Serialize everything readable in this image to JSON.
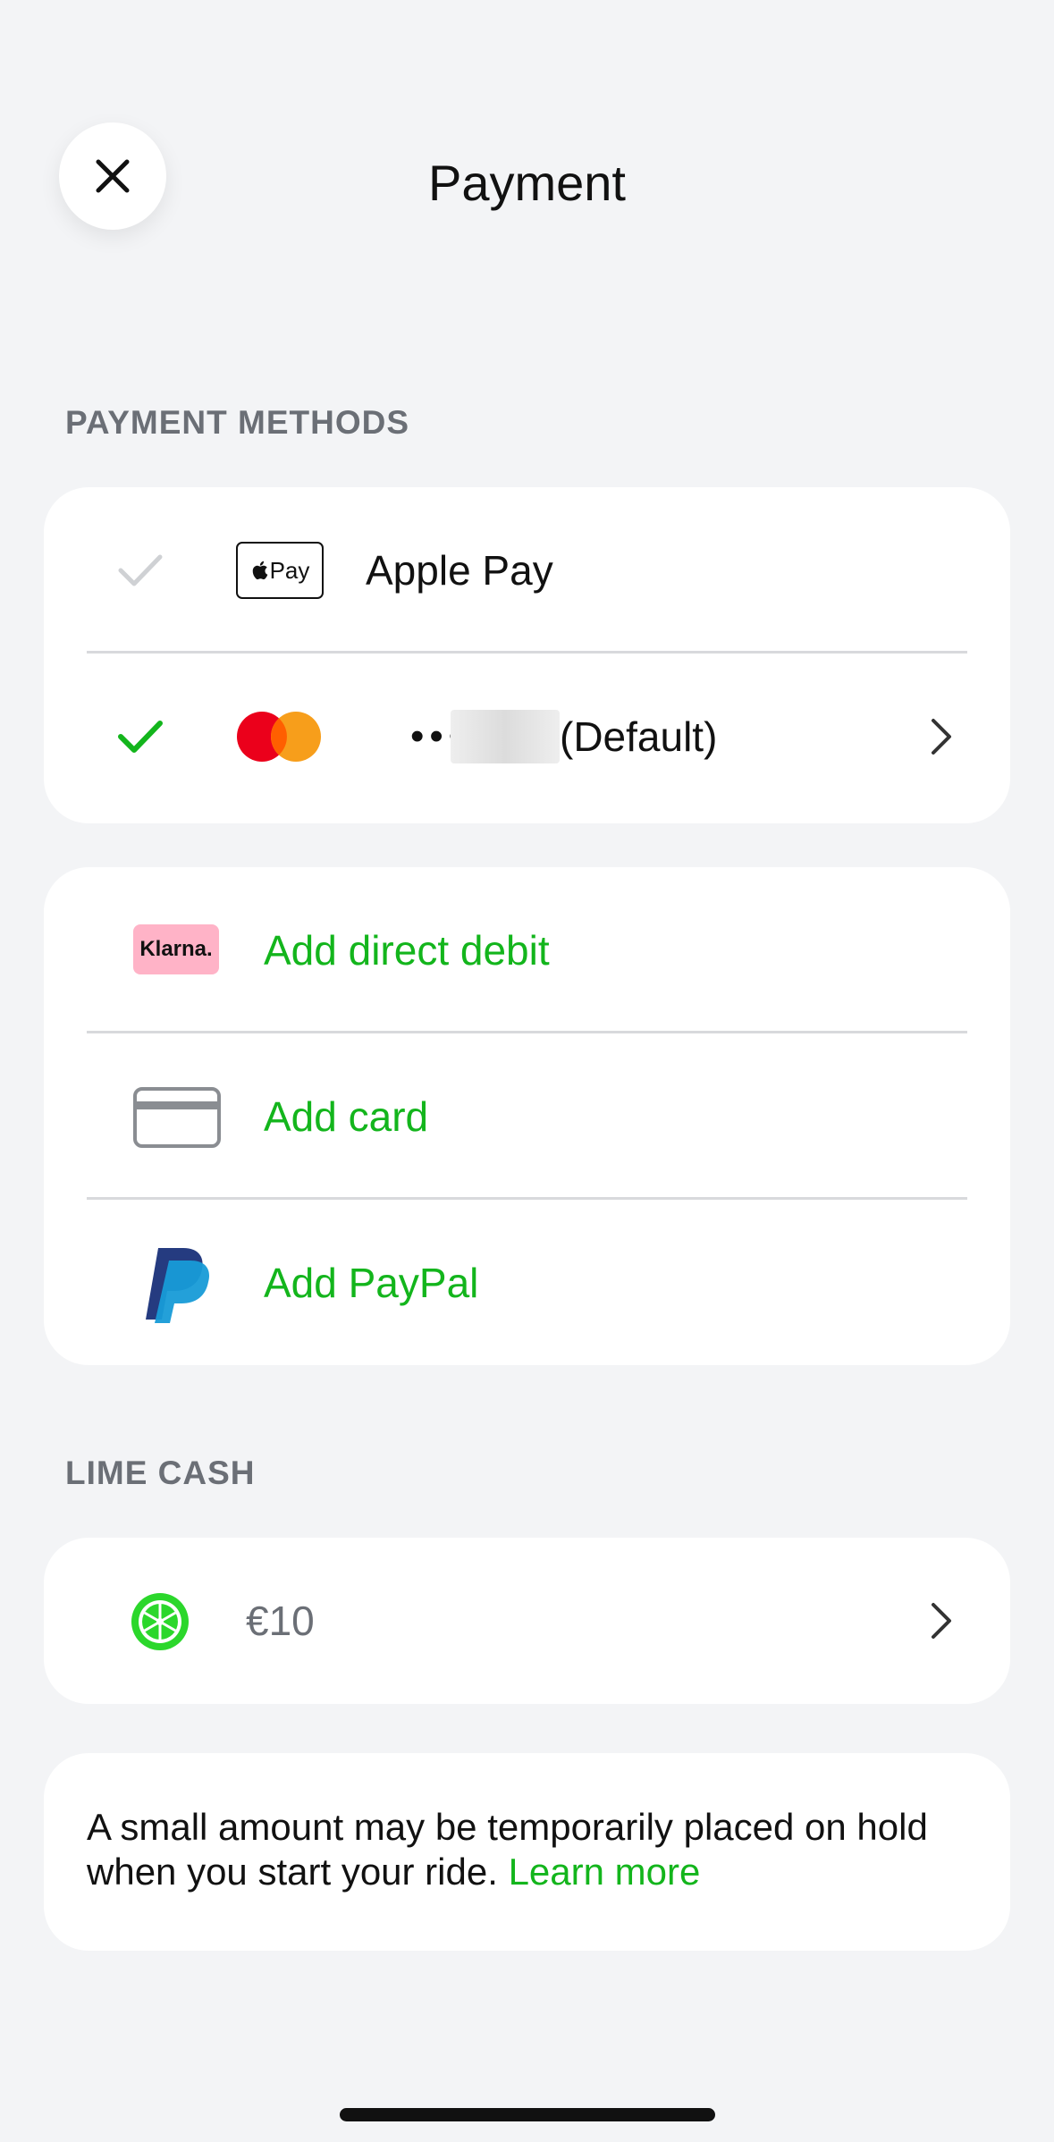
{
  "header": {
    "title": "Payment",
    "close_icon": "close-icon"
  },
  "payment_methods": {
    "section_label": "PAYMENT METHODS",
    "items": [
      {
        "icon": "apple-pay-icon",
        "badge_text": "Pay",
        "label": "Apple Pay",
        "selected": false
      },
      {
        "icon": "mastercard-icon",
        "masked_prefix": "••••",
        "suffix": "(Default)",
        "selected": true,
        "chevron": "chevron-right-icon"
      }
    ]
  },
  "add_methods": {
    "items": [
      {
        "icon": "klarna-icon",
        "badge_text": "Klarna.",
        "label": "Add direct debit"
      },
      {
        "icon": "card-icon",
        "label": "Add card"
      },
      {
        "icon": "paypal-icon",
        "label": "Add PayPal"
      }
    ]
  },
  "lime_cash": {
    "section_label": "LIME CASH",
    "icon": "lime-icon",
    "balance": "€10",
    "chevron": "chevron-right-icon"
  },
  "note": {
    "text": "A small amount may be temporarily placed on hold when you start your ride.",
    "link": "Learn more"
  },
  "colors": {
    "accent": "#13b51c",
    "background": "#f3f4f6",
    "klarna_pink": "#ffb3c7",
    "paypal_dark": "#253b80",
    "paypal_light": "#179bd7"
  }
}
